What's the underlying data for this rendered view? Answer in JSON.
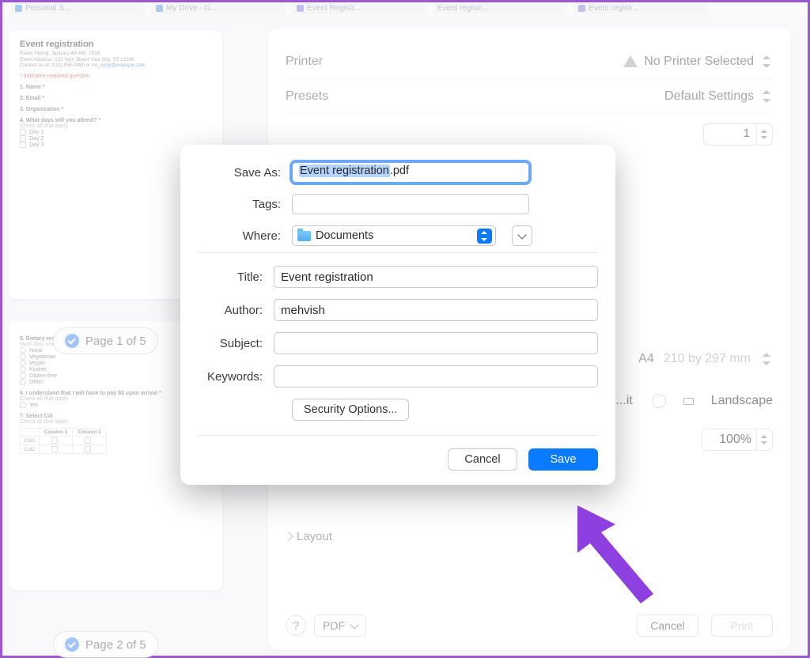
{
  "tabs": {
    "t0": "Personal S...",
    "t1": "My Drive - G...",
    "t2": "Event Registr...",
    "t3": "Event registr...",
    "t4": "Event registr..."
  },
  "print_panel": {
    "printer_label": "Printer",
    "printer_status": "No Printer Selected",
    "presets_label": "Presets",
    "presets_value": "Default Settings",
    "copies_value": "1",
    "paper_size": "A4",
    "paper_dim": "210 by 297 mm",
    "portrait": "Port...it",
    "landscape": "Landscape",
    "scale": "100%",
    "layout_label": "Layout",
    "help": "?",
    "pdf_btn": "PDF",
    "cancel": "Cancel",
    "print": "Print"
  },
  "thumbs": {
    "page1_label": "Page 1 of 5",
    "page2_label": "Page 2 of 5",
    "p1": {
      "title": "Event registration",
      "sub1": "Event Timing: January 4th-6th, 2016",
      "sub2": "Event Address: 123 Your Street Your City, ST 12345",
      "sub3a": "Contact us at (123) 456-7890 or no_",
      "sub3b": "reply@example.com",
      "req": "* Indicates required question",
      "q1": "1.  Name *",
      "q2": "2.  Email *",
      "q3": "3.  Organization *",
      "q4": "4.  What days will you attend? *",
      "check_hint": "Check all that apply.",
      "d1": "Day 1",
      "d2": "Day 2",
      "d3": "Day 3"
    },
    "p2": {
      "q5": "5.  Dietary restrictions *",
      "mark_hint": "Mark only one oval.",
      "o1": "None",
      "o2": "Vegetarian",
      "o3": "Vegan",
      "o4": "Kosher",
      "o5": "Gluten-free",
      "o6": "Other:",
      "q6": "6.  I understand that I will have to pay $$ upon arrival *",
      "check_hint": "Check all that apply.",
      "yes": "Yes",
      "q7": "7.  Select Col",
      "col1": "Column 1",
      "col2": "Column 2",
      "r1": "Col1",
      "r2": "Col2"
    }
  },
  "sheet": {
    "saveas_label": "Save As:",
    "filename_selected": "Event registration",
    "filename_ext": ".pdf",
    "tags_label": "Tags:",
    "where_label": "Where:",
    "where_value": "Documents",
    "title_label": "Title:",
    "title_value": "Event registration",
    "author_label": "Author:",
    "author_value": "mehvish",
    "subject_label": "Subject:",
    "keywords_label": "Keywords:",
    "security_btn": "Security Options...",
    "cancel": "Cancel",
    "save": "Save"
  }
}
